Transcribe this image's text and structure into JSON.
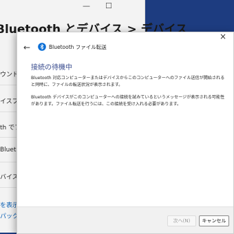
{
  "background": {
    "title": "Bluetooth とデバイス  >  デバイス",
    "items": [
      {
        "label": "ウンド",
        "link": false
      },
      {
        "label": "イスプレイ",
        "link": false
      },
      {
        "label": "th でファイ",
        "link": false
      },
      {
        "label": "Bluetoot",
        "link": false
      },
      {
        "label": "バイスと",
        "link": false
      },
      {
        "label": "を表示",
        "link": true
      },
      {
        "label": "パックの追",
        "link": true
      }
    ],
    "window_controls": [
      "—",
      "☐"
    ]
  },
  "dialog": {
    "title": "Bluetooth ファイル転送",
    "back_symbol": "←",
    "close_symbol": "×",
    "heading": "接続の待機中",
    "paragraph1": "Bluetooth 対応コンピューターまたはデバイスからこのコンピューターへのファイル送信が開始されると同時に、ファイルの転送状況が表示されます。",
    "paragraph2": "Bluetooth デバイスがこのコンピューターへの接続を試みているというメッセージが表示される可能性があります。ファイル転送を行うには、この接続を受け入れる必要があります。",
    "next_label": "次へ(N)",
    "cancel_label": "キャンセル"
  },
  "colors": {
    "desktop": "#1d3c80",
    "heading": "#3a4d8f",
    "bluetooth": "#0b6fd6",
    "link": "#0a5fb4"
  }
}
